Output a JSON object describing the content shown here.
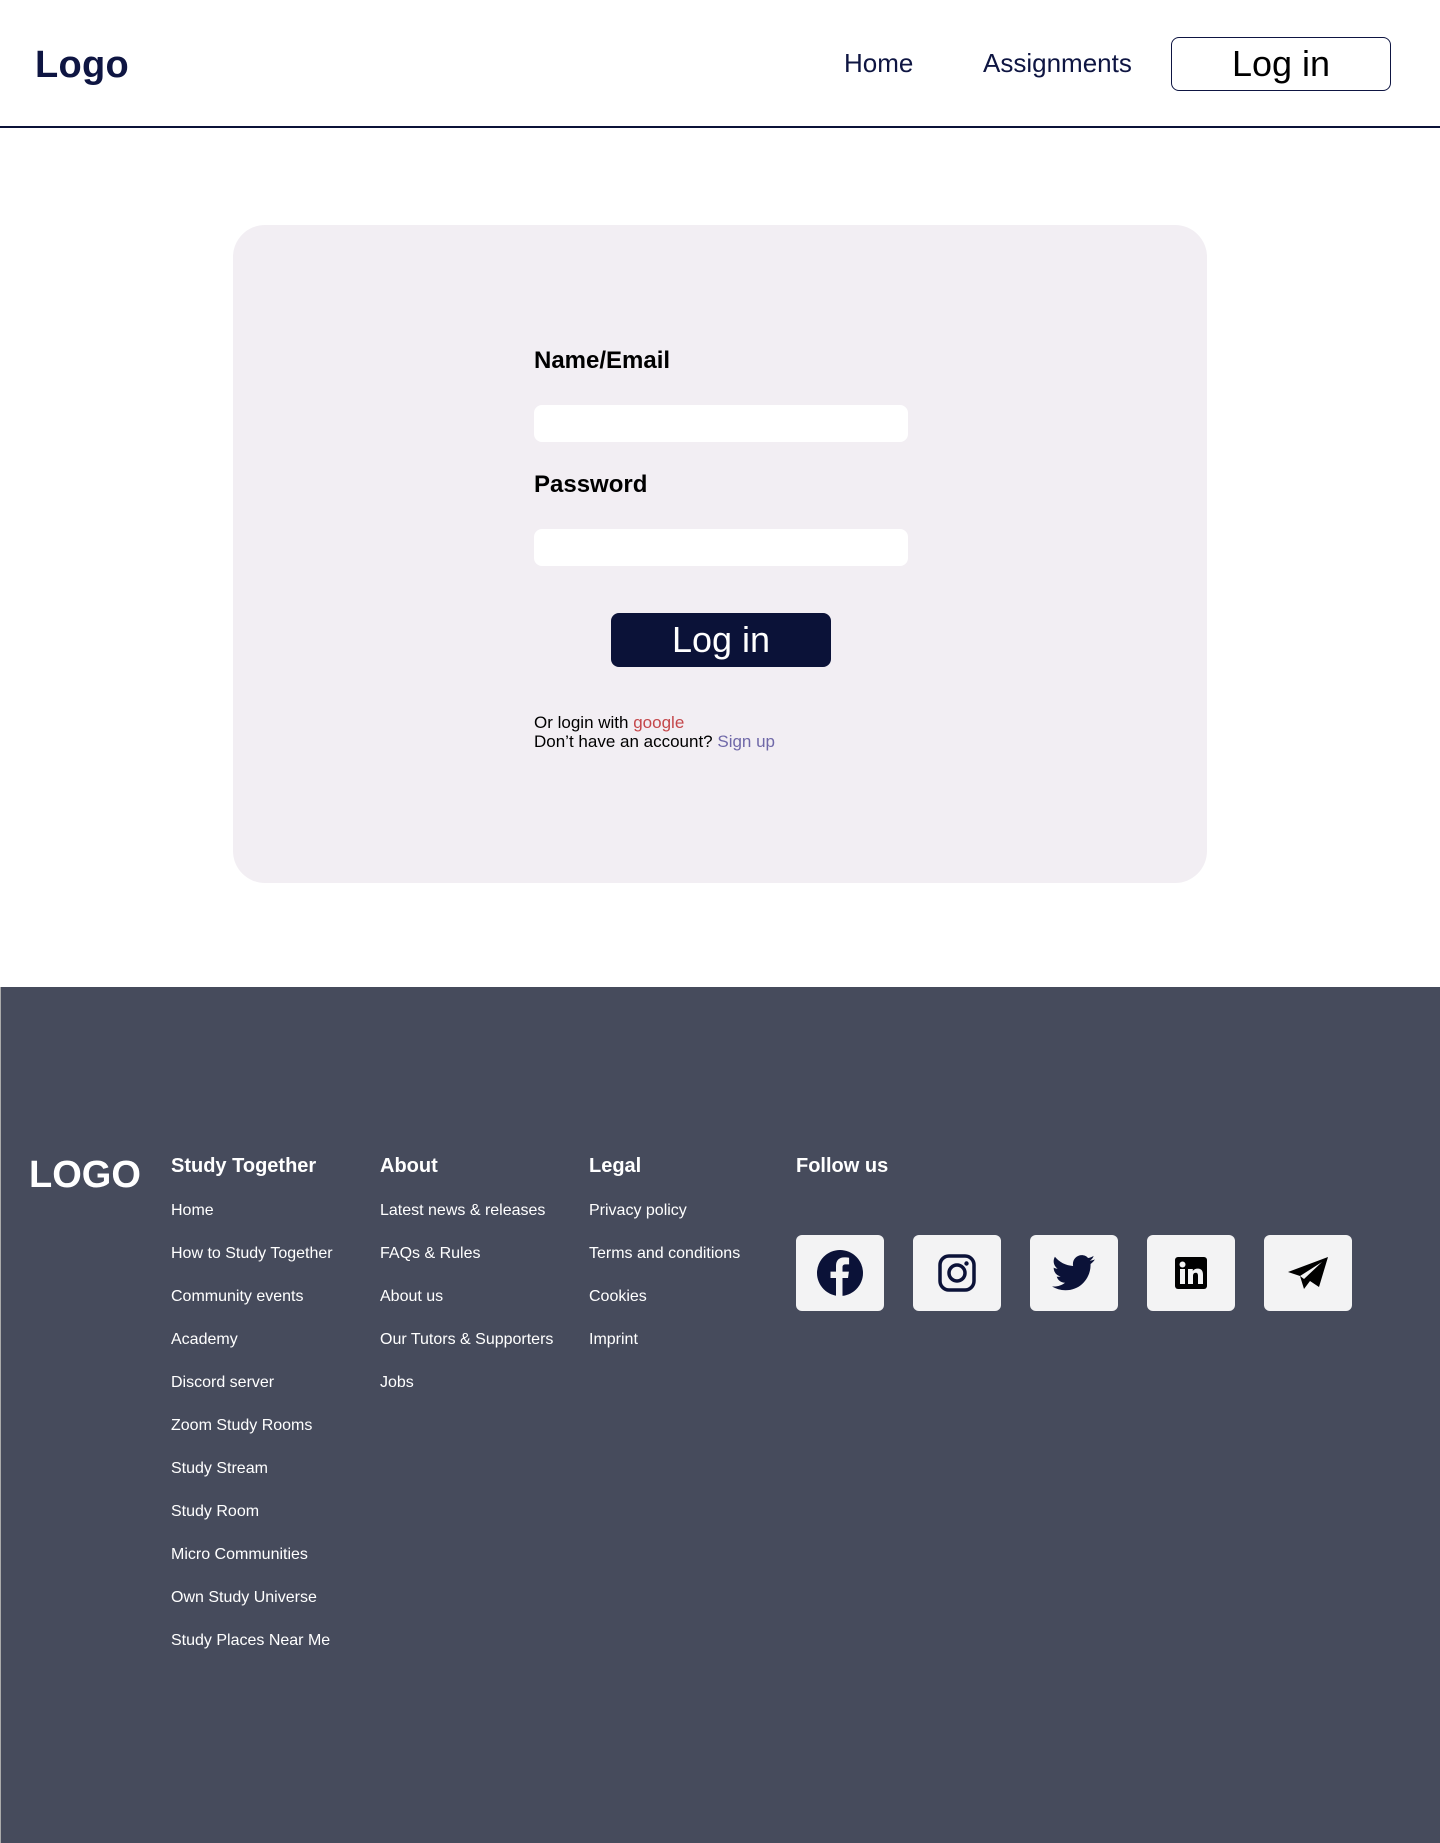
{
  "header": {
    "logo": "Logo",
    "nav": [
      {
        "label": "Home"
      },
      {
        "label": "Assignments"
      }
    ],
    "login_label": "Log in"
  },
  "login_form": {
    "name_label": "Name/Email",
    "name_value": "",
    "password_label": "Password",
    "password_value": "",
    "submit_label": "Log in",
    "alt_login_prefix": "Or login with",
    "alt_login_link": "google",
    "signup_prefix": "Don’t have an account?",
    "signup_link": "Sign up"
  },
  "footer": {
    "logo": "LOGO",
    "columns": [
      {
        "title": "Study Together",
        "links": [
          "Home",
          "How to Study Together",
          "Community events",
          "Academy",
          "Discord server",
          "Zoom Study Rooms",
          "Study Stream",
          "Study Room",
          "Micro Communities",
          "Own Study Universe",
          "Study Places Near Me"
        ]
      },
      {
        "title": "About",
        "links": [
          "Latest news & releases",
          "FAQs & Rules",
          "About us",
          "Our Tutors & Supporters",
          "Jobs"
        ]
      },
      {
        "title": "Legal",
        "links": [
          "Privacy policy",
          "Terms and conditions",
          "Cookies",
          "Imprint"
        ]
      }
    ],
    "follow_title": "Follow us",
    "socials": [
      "facebook-icon",
      "instagram-icon",
      "twitter-icon",
      "linkedin-icon",
      "telegram-icon"
    ]
  },
  "colors": {
    "navy": "#0b1238",
    "card_bg": "#f2eef3",
    "footer_bg": "#464b5c",
    "google_link": "#c4464a",
    "signup_link": "#6f68a8"
  }
}
